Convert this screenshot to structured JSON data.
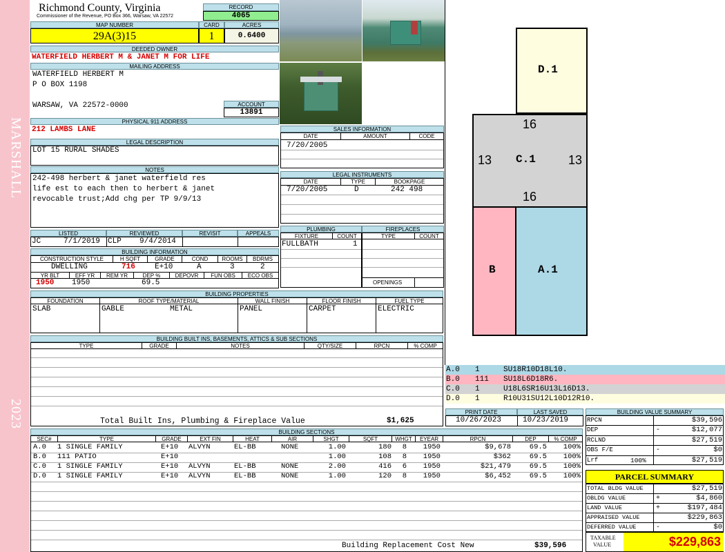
{
  "county": {
    "title": "Richmond County, Virginia",
    "subtitle": "Commissioner of the Revenue, PO Box 366, Warsaw, VA 22572"
  },
  "side": {
    "district": "MARSHALL",
    "year": "2023"
  },
  "record": {
    "label": "RECORD",
    "value": "4065"
  },
  "map": {
    "label": "MAP NUMBER",
    "value": "29A(3)15"
  },
  "card": {
    "label": "CARD",
    "value": "1"
  },
  "acres": {
    "label": "ACRES",
    "value": "0.6400"
  },
  "owner": {
    "label": "DEEDED OWNER",
    "value": "WATERFIELD HERBERT M & JANET M FOR LIFE"
  },
  "mailing": {
    "label": "MAILING ADDRESS",
    "line1": "WATERFIELD HERBERT M",
    "line2": "P O BOX 1198",
    "line3": "WARSAW, VA 22572-0000"
  },
  "account": {
    "label": "ACCOUNT",
    "value": "13891"
  },
  "physical": {
    "label": "PHYSICAL 911 ADDRESS",
    "value": "212 LAMBS LANE"
  },
  "legal": {
    "label": "LEGAL DESCRIPTION",
    "value": "LOT 15 RURAL SHADES"
  },
  "notes": {
    "label": "NOTES",
    "line1": "242-498 herbert & janet waterfield res",
    "line2": "life est to each then to herbert & janet",
    "line3": "revocable trust;Add chg per TP 9/9/13"
  },
  "sales": {
    "label": "SALES INFORMATION",
    "cols": [
      "DATE",
      "AMOUNT",
      "CODE"
    ],
    "rows": [
      [
        "7/20/2005",
        "",
        ""
      ]
    ]
  },
  "instruments": {
    "label": "LEGAL INSTRUMENTS",
    "cols": [
      "DATE",
      "TYPE",
      "BOOKPAGE"
    ],
    "rows": [
      [
        "7/20/2005",
        "D",
        "242 498"
      ]
    ]
  },
  "listed": {
    "labels": [
      "LISTED",
      "REVIEWED",
      "REVISIT",
      "APPEALS"
    ],
    "listed_by": "JC",
    "listed_date": "7/1/2019",
    "reviewed_by": "CLP",
    "reviewed_date": "9/4/2014"
  },
  "building": {
    "label": "BUILDING INFORMATION",
    "cols1": [
      "CONSTRUCTION STYLE",
      "H SQFT",
      "GRADE",
      "COND",
      "ROOMS",
      "BDRMS"
    ],
    "vals1": [
      "DWELLING",
      "716",
      "E+10",
      "A",
      "3",
      "2"
    ],
    "cols2": [
      "YR BLT",
      "EFF YR",
      "REM YR",
      "DEP %",
      "DEPOVR",
      "FUN OBS",
      "ECO OBS"
    ],
    "vals2": [
      "1950",
      "1950",
      "",
      "69.5",
      "",
      "",
      ""
    ]
  },
  "plumbing": {
    "label": "PLUMBING",
    "cols": [
      "FIXTURE",
      "COUNT"
    ],
    "rows": [
      [
        "FULLBATH",
        "1"
      ]
    ]
  },
  "fireplaces": {
    "label": "FIREPLACES",
    "cols": [
      "TYPE",
      "COUNT"
    ],
    "openings": "OPENINGS"
  },
  "properties": {
    "label": "BUILDING PROPERTIES",
    "cols": [
      "FOUNDATION",
      "ROOF TYPE/MATERIAL",
      "WALL FINISH",
      "FLOOR FINISH",
      "FUEL TYPE"
    ],
    "foundation": "SLAB",
    "roof_type": "GABLE",
    "roof_material": "METAL",
    "wall": "PANEL",
    "floor": "CARPET",
    "fuel": "ELECTRIC"
  },
  "builtins": {
    "label": "BUILDING BUILT INS, BASEMENTS, ATTICS & SUB SECTIONS",
    "cols": [
      "TYPE",
      "GRADE",
      "NOTES",
      "QTY/SIZE",
      "RPCN",
      "% COMP"
    ],
    "total_label": "Total Built Ins, Plumbing & Fireplace Value",
    "total_value": "$1,625"
  },
  "sketch": {
    "labels": [
      "D.1",
      "C.1",
      "B",
      "A.1"
    ],
    "dims": [
      "16",
      "13",
      "13",
      "16"
    ],
    "legend": [
      {
        "code": "A.0",
        "count": "1",
        "path": "SU18R10D18L10.",
        "color": "#add8e6"
      },
      {
        "code": "B.0",
        "count": "111",
        "path": "SU18L6D18R6.",
        "color": "#ffb6c1"
      },
      {
        "code": "C.0",
        "count": "1",
        "path": "U18L6SR16U13L16D13.",
        "color": "#d3d3d3"
      },
      {
        "code": "D.0",
        "count": "1",
        "path": "R10U31SU12L10D12R10.",
        "color": "#fffde0"
      }
    ]
  },
  "dates": {
    "print_label": "PRINT DATE",
    "print": "10/26/2023",
    "saved_label": "LAST SAVED",
    "saved": "10/23/2019"
  },
  "sections": {
    "label": "BUILDING SECTIONS",
    "cols": [
      "SEC#",
      "TYPE",
      "GRADE",
      "EXT FIN",
      "HEAT",
      "AIR",
      "SHGT",
      "SQFT",
      "WHGT",
      "EYEAR",
      "RPCN",
      "DEP",
      "% COMP"
    ],
    "rows": [
      [
        "A.0",
        "1 SINGLE FAMILY",
        "E+10",
        "ALVYN",
        "EL-BB",
        "NONE",
        "1.00",
        "180",
        "8",
        "1950",
        "$9,678",
        "69.5",
        "100%"
      ],
      [
        "B.0",
        "111 PATIO",
        "E+10",
        "",
        "",
        "",
        "1.00",
        "108",
        "8",
        "1950",
        "$362",
        "69.5",
        "100%"
      ],
      [
        "C.0",
        "1 SINGLE FAMILY",
        "E+10",
        "ALVYN",
        "EL-BB",
        "NONE",
        "2.00",
        "416",
        "6",
        "1950",
        "$21,479",
        "69.5",
        "100%"
      ],
      [
        "D.0",
        "1 SINGLE FAMILY",
        "E+10",
        "ALVYN",
        "EL-BB",
        "NONE",
        "1.00",
        "120",
        "8",
        "1950",
        "$6,452",
        "69.5",
        "100%"
      ]
    ],
    "total_label": "Building Replacement Cost New",
    "total_value": "$39,596"
  },
  "value_summary": {
    "label": "BUILDING VALUE SUMMARY",
    "rows": [
      {
        "label": "RPCN",
        "sign": "",
        "value": "$39,596"
      },
      {
        "label": "DEP",
        "sign": "-",
        "value": "$12,077"
      },
      {
        "label": "RCLND",
        "sign": "",
        "value": "$27,519"
      },
      {
        "label": "OBS F/E",
        "sign": "-",
        "value": "$0"
      },
      {
        "label": "Lrf",
        "pct": "100%",
        "sign": "",
        "value": "$27,519"
      }
    ]
  },
  "parcel": {
    "label": "PARCEL SUMMARY",
    "rows": [
      {
        "label": "TOTAL BLDG VALUE",
        "sign": "",
        "value": "$27,519"
      },
      {
        "label": "OBLDG VALUE",
        "sign": "+",
        "value": "$4,860"
      },
      {
        "label": "LAND VALUE",
        "sign": "+",
        "value": "$197,484"
      },
      {
        "label": "APPRAISED VALUE",
        "sign": "",
        "value": "$229,863"
      },
      {
        "label": "DEFERRED VALUE",
        "sign": "-",
        "value": "$0"
      }
    ],
    "taxable_label1": "TAXABLE",
    "taxable_label2": "VALUE",
    "taxable_value": "$229,863"
  },
  "colors": {
    "side": "#f8c4cc",
    "header": "#bde0ea",
    "yellow": "#ffff00",
    "green": "#90ee90",
    "red": "#d40000"
  }
}
